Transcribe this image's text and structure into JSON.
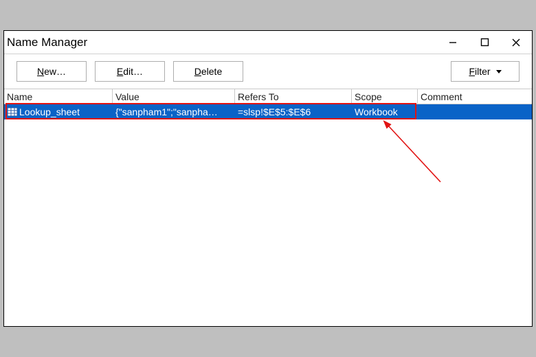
{
  "window": {
    "title": "Name Manager",
    "minimize_tip": "Minimize",
    "maximize_tip": "Maximize",
    "close_tip": "Close"
  },
  "toolbar": {
    "new_prefix": "N",
    "new_rest": "ew…",
    "edit_prefix": "E",
    "edit_rest": "dit…",
    "delete_prefix": "D",
    "delete_rest": "elete",
    "filter_prefix": "F",
    "filter_rest": "ilter"
  },
  "columns": {
    "name": "Name",
    "value": "Value",
    "refers": "Refers To",
    "scope": "Scope",
    "comment": "Comment"
  },
  "rows": [
    {
      "name": "Lookup_sheet",
      "value": "{\"sanpham1\";\"sanpha…",
      "refers": "=slsp!$E$5:$E$6",
      "scope": "Workbook",
      "comment": ""
    }
  ]
}
